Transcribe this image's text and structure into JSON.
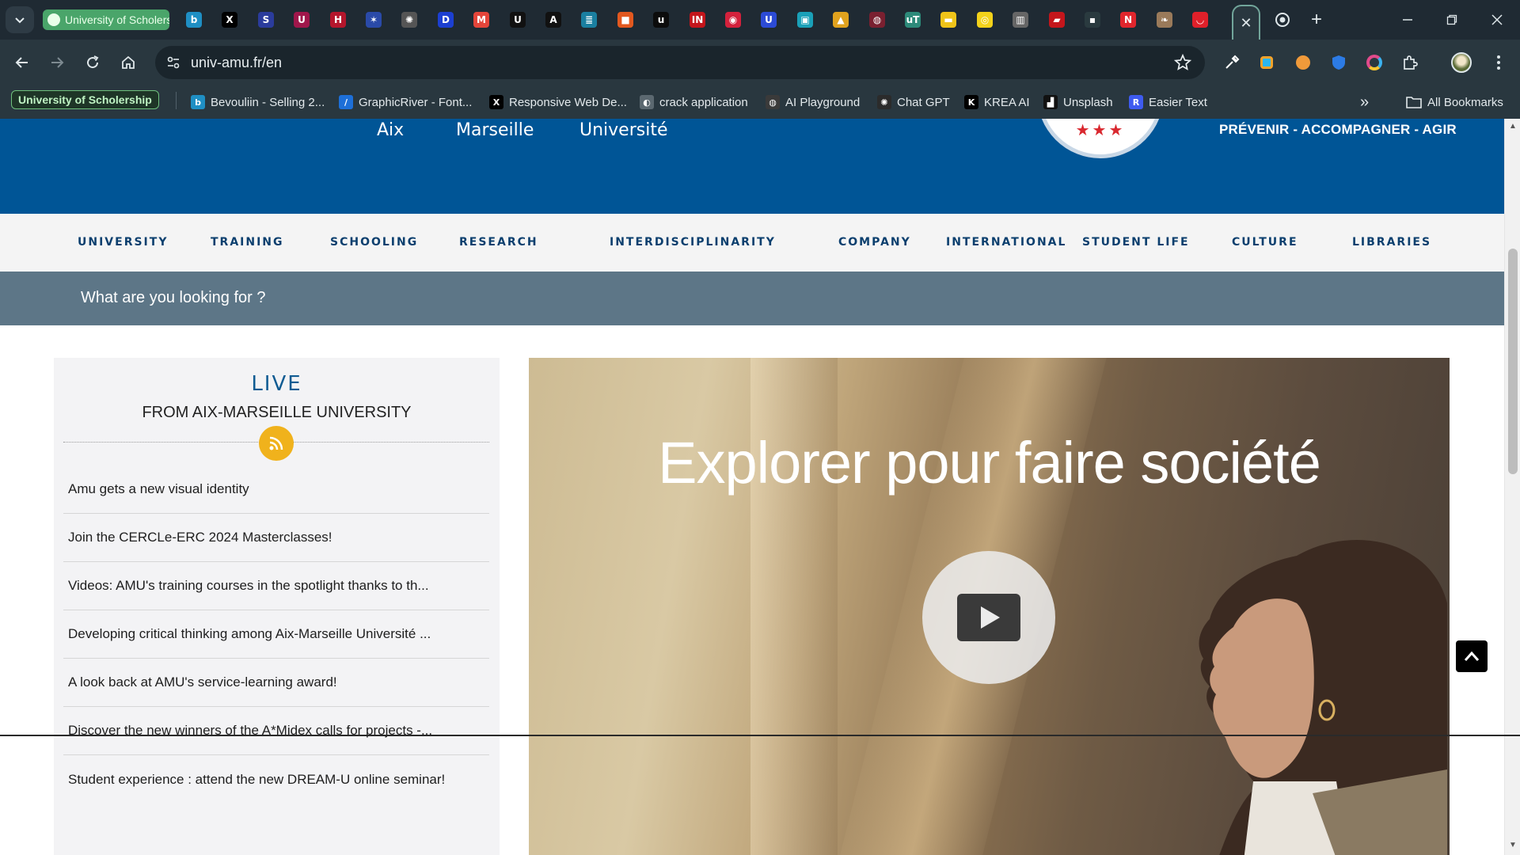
{
  "browser": {
    "active_tab_title": "University of Scholership",
    "current_tab_close": "✕",
    "new_tab": "+",
    "url": "univ-amu.fr/en",
    "tab_favicons": [
      {
        "icon": "bevouliin-icon",
        "glyph": "b",
        "color": "#1f8fc4"
      },
      {
        "icon": "x-icon",
        "glyph": "X",
        "color": "#000000"
      },
      {
        "icon": "s-icon",
        "glyph": "S",
        "color": "#2b3c9c"
      },
      {
        "icon": "u-icon",
        "glyph": "U",
        "color": "#a0174b"
      },
      {
        "icon": "h-icon",
        "glyph": "H",
        "color": "#b4162c"
      },
      {
        "icon": "star-blue-icon",
        "glyph": "✶",
        "color": "#2a4aa8"
      },
      {
        "icon": "aperture-icon",
        "glyph": "✺",
        "color": "#555555"
      },
      {
        "icon": "d-icon",
        "glyph": "D",
        "color": "#1c3fd1"
      },
      {
        "icon": "m-icon",
        "glyph": "M",
        "color": "#e4453a"
      },
      {
        "icon": "unsplash-u-icon",
        "glyph": "U",
        "color": "#111111"
      },
      {
        "icon": "a-icon",
        "glyph": "A",
        "color": "#111111"
      },
      {
        "icon": "lines-icon",
        "glyph": "≣",
        "color": "#1a7fa0"
      },
      {
        "icon": "orange-box-icon",
        "glyph": "■",
        "color": "#e2581f"
      },
      {
        "icon": "u-lower-icon",
        "glyph": "u",
        "color": "#0c0c0c"
      },
      {
        "icon": "insa-icon",
        "glyph": "IN",
        "color": "#c4161c"
      },
      {
        "icon": "red-badge-icon",
        "glyph": "◉",
        "color": "#d4213c"
      },
      {
        "icon": "shield-u-icon",
        "glyph": "U",
        "color": "#2c4bd6"
      },
      {
        "icon": "teal-square-icon",
        "glyph": "▣",
        "color": "#1aa0b8"
      },
      {
        "icon": "triangle-icon",
        "glyph": "▲",
        "color": "#e0a21e"
      },
      {
        "icon": "crest-icon",
        "glyph": "◍",
        "color": "#7a2030"
      },
      {
        "icon": "ut-icon",
        "glyph": "uT",
        "color": "#2d8a7a"
      },
      {
        "icon": "yellow-bar-icon",
        "glyph": "▬",
        "color": "#f0c419"
      },
      {
        "icon": "yellow-circle-icon",
        "glyph": "◎",
        "color": "#f3d21a"
      },
      {
        "icon": "doc-icon",
        "glyph": "▥",
        "color": "#666666"
      },
      {
        "icon": "red-book-icon",
        "glyph": "▰",
        "color": "#c4161c"
      },
      {
        "icon": "dark-icon",
        "glyph": "▪",
        "color": "#2a3a3f"
      },
      {
        "icon": "n-icon",
        "glyph": "N",
        "color": "#e1262d"
      },
      {
        "icon": "squirrel-icon",
        "glyph": "❧",
        "color": "#9a7a5a"
      },
      {
        "icon": "lips-icon",
        "glyph": "◡",
        "color": "#e0202a"
      }
    ]
  },
  "bookmarks": {
    "pill": "University of Scholership",
    "items": [
      {
        "label": "Bevouliin - Selling 2...",
        "icon": "bevouliin-icon",
        "glyph": "b",
        "color": "#1f8fc4"
      },
      {
        "label": "GraphicRiver - Font...",
        "icon": "graphicriver-icon",
        "glyph": "/",
        "color": "#1d6fd8"
      },
      {
        "label": "Responsive Web De...",
        "icon": "x-icon",
        "glyph": "X",
        "color": "#000000"
      },
      {
        "label": "crack application",
        "icon": "globe-icon",
        "glyph": "◐",
        "color": "#5b6870"
      },
      {
        "label": "AI Playground",
        "icon": "ai-playground-icon",
        "glyph": "◍",
        "color": "#3a3a3a"
      },
      {
        "label": "Chat GPT",
        "icon": "chatgpt-icon",
        "glyph": "✺",
        "color": "#2b2b2b"
      },
      {
        "label": "KREA AI",
        "icon": "krea-icon",
        "glyph": "K",
        "color": "#000000"
      },
      {
        "label": "Unsplash",
        "icon": "unsplash-icon",
        "glyph": "▟",
        "color": "#111111"
      },
      {
        "label": "Easier Text",
        "icon": "easier-text-icon",
        "glyph": "R",
        "color": "#3e5bf0"
      }
    ],
    "overflow": "»",
    "all_bookmarks": "All Bookmarks"
  },
  "site": {
    "logo_words": [
      "Aix",
      "Marseille",
      "Université"
    ],
    "slogan": "PRÉVENIR - ACCOMPAGNER - AGIR",
    "emblem_stars": "★★★",
    "nav": [
      "UNIVERSITY",
      "TRAINING",
      "SCHOOLING",
      "RESEARCH",
      "INTERDISCIPLINARITY",
      "COMPANY",
      "INTERNATIONAL",
      "STUDENT LIFE",
      "CULTURE",
      "LIBRARIES"
    ],
    "search_placeholder": "What are you looking for ?",
    "live": {
      "title": "LIVE",
      "subtitle": "FROM AIX-MARSEILLE UNIVERSITY",
      "news": [
        "Amu gets a new visual identity",
        "Join the CERCLe-ERC 2024 Masterclasses!",
        "Videos: AMU's training courses in the spotlight thanks to th...",
        "Developing critical thinking among Aix-Marseille Université ...",
        "A look back at AMU's service-learning award!",
        "Discover the new winners of the A*Midex calls for projects -...",
        "Student experience : attend the new DREAM-U online seminar!"
      ]
    },
    "video": {
      "title": "Explorer pour faire société"
    }
  },
  "colors": {
    "brand_blue": "#005596",
    "nav_text": "#0b3f6e",
    "search_bar": "#5d7687",
    "rss": "#f0b21c",
    "live_title": "#0f5b92"
  }
}
